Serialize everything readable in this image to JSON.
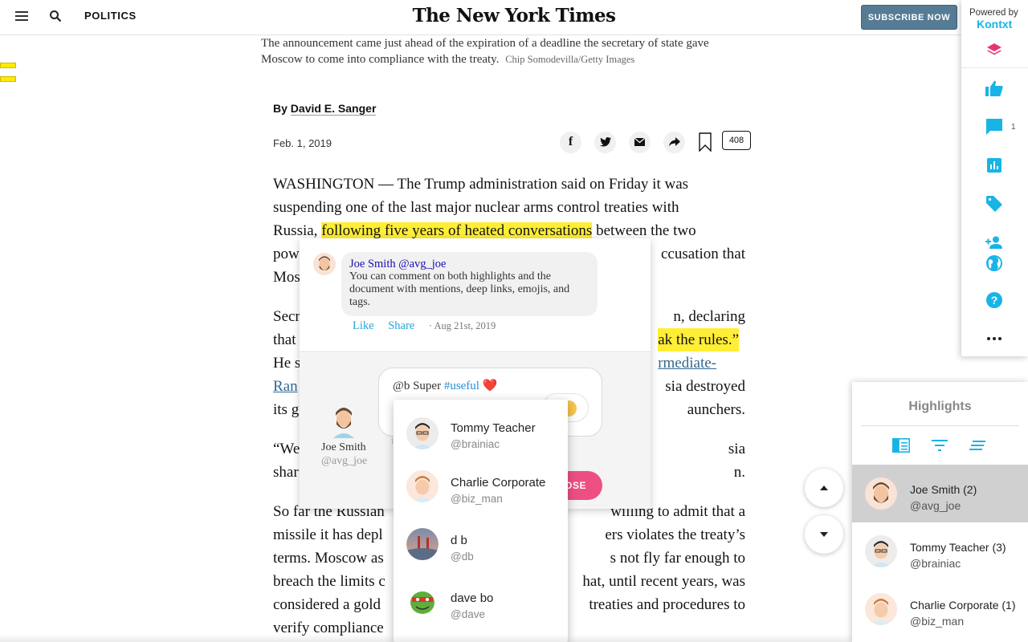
{
  "header": {
    "section": "POLITICS",
    "masthead": "The New York Times",
    "subscribe_label": "SUBSCRIBE NOW"
  },
  "article": {
    "caption_text": "The announcement came just ahead of the expiration of a deadline the secretary of state gave Moscow to come into compliance with the treaty.",
    "caption_credit": "Chip Somodevilla/Getty Images",
    "byline_prefix": "By ",
    "author": "David E. Sanger",
    "date": "Feb. 1, 2019",
    "comment_count": "408",
    "lines": [
      {
        "pre": "WASHINGTON — The Trump administration said on Friday it was"
      },
      {
        "pre": "suspending one of the last major nuclear arms control treaties with"
      },
      {
        "pre": "Russia, ",
        "hl": "following five years of heated conversations",
        "post": " between the two"
      },
      {
        "pre": "pow",
        "post": "ccusation that"
      },
      {
        "pre": "Mos"
      },
      {
        "pre": "Secr",
        "post": "n, declaring"
      },
      {
        "pre": "that",
        "hl": "ak the rules.”"
      },
      {
        "pre": "He s",
        "link": "rmediate-"
      },
      {
        "link_pre": "Ran",
        "post": "sia destroyed"
      },
      {
        "pre": "its g",
        "post": "aunchers."
      },
      {
        "pre": "“We",
        "post": "sia"
      },
      {
        "pre": "shar",
        "post": "n."
      },
      {
        "pre": "So far the Russian",
        "post": "willing to admit that a"
      },
      {
        "pre": "missile it has depl",
        "post": "ers violates the treaty’s"
      },
      {
        "pre": "terms. Moscow as",
        "post": "s not fly far enough to"
      },
      {
        "pre": "breach the limits c",
        "post": "hat, until recent years, was"
      },
      {
        "pre": "considered a gold",
        "post": " treaties and procedures to"
      },
      {
        "pre": "verify compliance"
      }
    ]
  },
  "comment": {
    "author": "Joe Smith @avg_joe",
    "text": "You can comment on both highlights and the document with mentions, deep links, emojis, and tags.",
    "like": "Like",
    "share": "Share",
    "timestamp": "Aug 21st, 2019",
    "me_name": "Joe Smith",
    "me_handle": "@avg_joe",
    "draft_prefix": "@b Super ",
    "draft_tag": "#useful",
    "draft_emoji": "❤️",
    "post_label": "OSE"
  },
  "mentions": [
    {
      "name": "Tommy Teacher",
      "handle": "@brainiac"
    },
    {
      "name": "Charlie Corporate",
      "handle": "@biz_man"
    },
    {
      "name": "d b",
      "handle": "@db"
    },
    {
      "name": "dave bo",
      "handle": "@dave"
    }
  ],
  "kontxt": {
    "powered_by": "Powered by",
    "brand": "Kontxt",
    "comment_badge": "1",
    "icons": [
      "layers-icon",
      "thumbs-up-icon",
      "comment-icon",
      "bar-chart-icon",
      "tag-icon",
      "add-user-icon",
      "globe-icon",
      "help-icon",
      "more-icon"
    ],
    "accent": "#18b4e6",
    "pink": "#e8356d"
  },
  "highlights": {
    "title": "Highlights",
    "rows": [
      {
        "name": "Joe Smith (2)",
        "handle": "@avg_joe"
      },
      {
        "name": "Tommy Teacher (3)",
        "handle": "@brainiac"
      },
      {
        "name": "Charlie Corporate (1)",
        "handle": "@biz_man"
      }
    ]
  }
}
